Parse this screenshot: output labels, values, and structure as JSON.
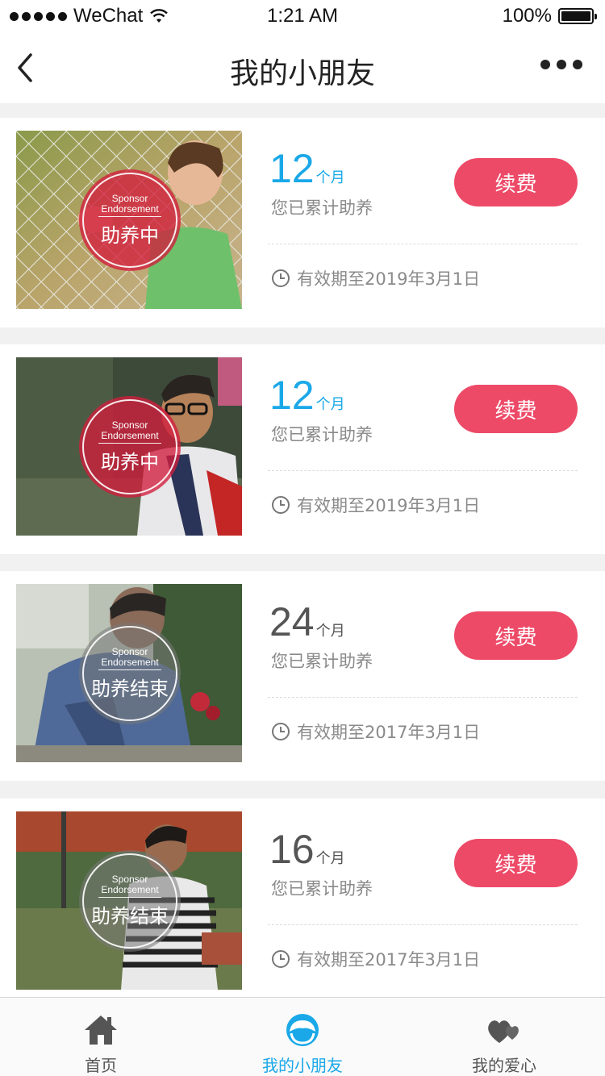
{
  "status_bar": {
    "carrier": "WeChat",
    "time": "1:21 AM",
    "battery": "100%"
  },
  "nav": {
    "title": "我的小朋友"
  },
  "children": [
    {
      "months": "12",
      "unit": "个月",
      "subtext": "您已累计助养",
      "renew_label": "续费",
      "expiry": "有效期至2019年3月1日",
      "seal_en_1": "Sponsor",
      "seal_en_2": "Endorsement",
      "seal_cn": "助养中",
      "status": "active"
    },
    {
      "months": "12",
      "unit": "个月",
      "subtext": "您已累计助养",
      "renew_label": "续费",
      "expiry": "有效期至2019年3月1日",
      "seal_en_1": "Sponsor",
      "seal_en_2": "Endorsement",
      "seal_cn": "助养中",
      "status": "active"
    },
    {
      "months": "24",
      "unit": "个月",
      "subtext": "您已累计助养",
      "renew_label": "续费",
      "expiry": "有效期至2017年3月1日",
      "seal_en_1": "Sponsor",
      "seal_en_2": "Endorsement",
      "seal_cn": "助养结束",
      "status": "ended"
    },
    {
      "months": "16",
      "unit": "个月",
      "subtext": "您已累计助养",
      "renew_label": "续费",
      "expiry": "有效期至2017年3月1日",
      "seal_en_1": "Sponsor",
      "seal_en_2": "Endorsement",
      "seal_cn": "助养结束",
      "status": "ended"
    }
  ],
  "tabs": [
    {
      "label": "首页",
      "icon": "home-icon"
    },
    {
      "label": "我的小朋友",
      "icon": "child-face-icon"
    },
    {
      "label": "我的爱心",
      "icon": "hearts-icon"
    }
  ],
  "colors": {
    "accent": "#1aa8e8",
    "button": "#ed4a68",
    "active_seal": "#d21e3c",
    "muted": "#8a8a8a"
  }
}
